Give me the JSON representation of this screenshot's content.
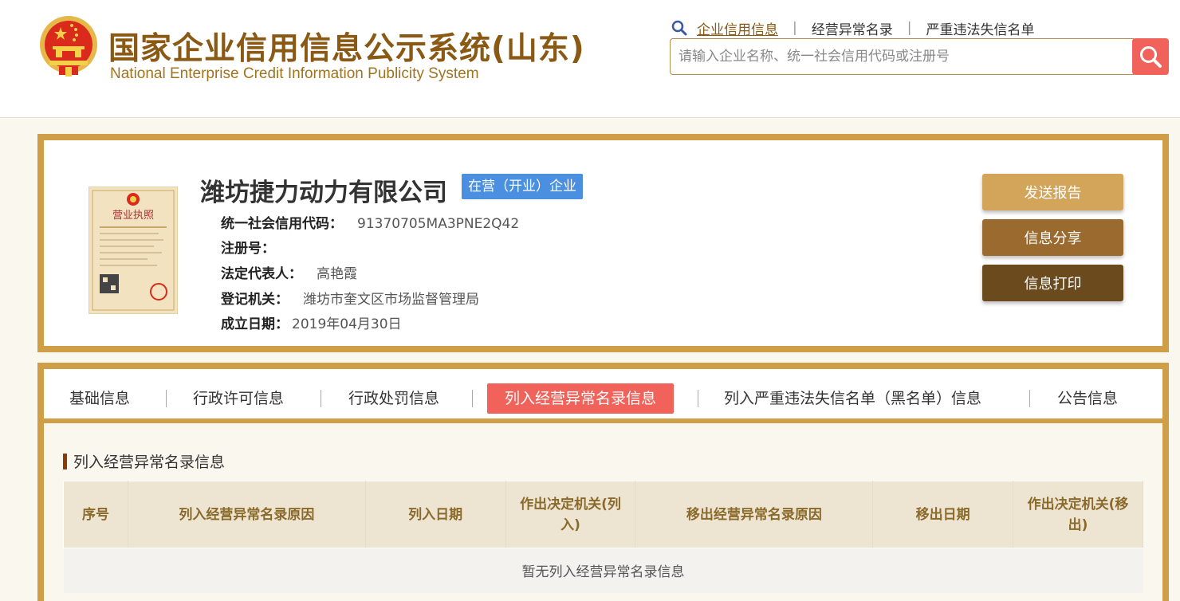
{
  "header": {
    "title_cn": "国家企业信用信息公示系统(山东)",
    "title_en": "National Enterprise Credit Information Publicity System",
    "nav": [
      {
        "label": "企业信用信息",
        "active": true
      },
      {
        "label": "经营异常名录",
        "active": false
      },
      {
        "label": "严重违法失信名单",
        "active": false
      }
    ],
    "search": {
      "placeholder": "请输入企业名称、统一社会信用代码或注册号",
      "value": "",
      "button_icon": "search-icon"
    }
  },
  "company": {
    "name": "潍坊捷力动力有限公司",
    "status": "在营（开业）企业",
    "license_icon": "business-license-image",
    "fields": [
      {
        "label": "统一社会信用代码：",
        "value": "91370705MA3PNE2Q42"
      },
      {
        "label": "注册号：",
        "value": ""
      },
      {
        "label": "法定代表人：",
        "value": "高艳霞"
      },
      {
        "label": "登记机关：",
        "value": "潍坊市奎文区市场监督管理局"
      },
      {
        "label": "成立日期：",
        "value": "2019年04月30日"
      }
    ],
    "actions": {
      "send_report": "发送报告",
      "share": "信息分享",
      "print": "信息打印"
    }
  },
  "tabs": [
    {
      "label": "基础信息",
      "active": false
    },
    {
      "label": "行政许可信息",
      "active": false
    },
    {
      "label": "行政处罚信息",
      "active": false
    },
    {
      "label": "列入经营异常名录信息",
      "active": true
    },
    {
      "label": "列入严重违法失信名单（黑名单）信息",
      "active": false
    },
    {
      "label": "公告信息",
      "active": false
    }
  ],
  "section": {
    "title": "列入经营异常名录信息",
    "columns": [
      "序号",
      "列入经营异常名录原因",
      "列入日期",
      "作出决定机关(列入)",
      "移出经营异常名录原因",
      "移出日期",
      "作出决定机关(移出)"
    ],
    "empty_text": "暂无列入经营异常名录信息"
  },
  "colors": {
    "gold": "#cf9e47",
    "brown_title": "#8a5a14",
    "active_red": "#f0625a",
    "badge_blue": "#4b8fe0"
  }
}
